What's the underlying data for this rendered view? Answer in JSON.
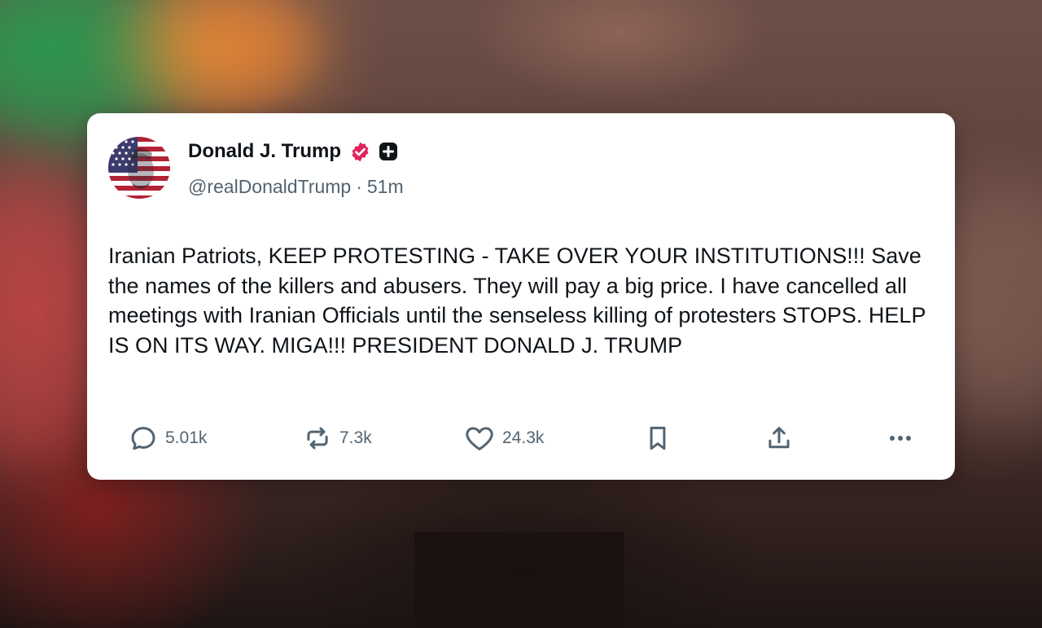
{
  "post": {
    "author": {
      "display_name": "Donald J. Trump",
      "handle": "@realDonaldTrump",
      "verified_icon": "verified-badge-icon",
      "verified_color": "#e0245e",
      "subscription_icon": "plus-badge-icon"
    },
    "time_separator": "·",
    "timestamp": "51m",
    "text": "Iranian Patriots, KEEP PROTESTING - TAKE OVER YOUR INSTITUTIONS!!! Save the names of the killers and abusers. They will pay a big price. I have cancelled all meetings with Iranian Officials until the senseless killing of protesters STOPS. HELP IS ON ITS WAY. MIGA!!! PRESIDENT DONALD J. TRUMP",
    "actions": {
      "replies": {
        "icon": "reply-icon",
        "count": "5.01k"
      },
      "reposts": {
        "icon": "repost-icon",
        "count": "7.3k"
      },
      "likes": {
        "icon": "heart-icon",
        "count": "24.3k"
      },
      "bookmark": {
        "icon": "bookmark-icon"
      },
      "share": {
        "icon": "share-icon"
      },
      "more": {
        "icon": "more-icon"
      }
    }
  },
  "colors": {
    "card_background": "#ffffff",
    "text_primary": "#0f1419",
    "text_secondary": "#536471"
  }
}
